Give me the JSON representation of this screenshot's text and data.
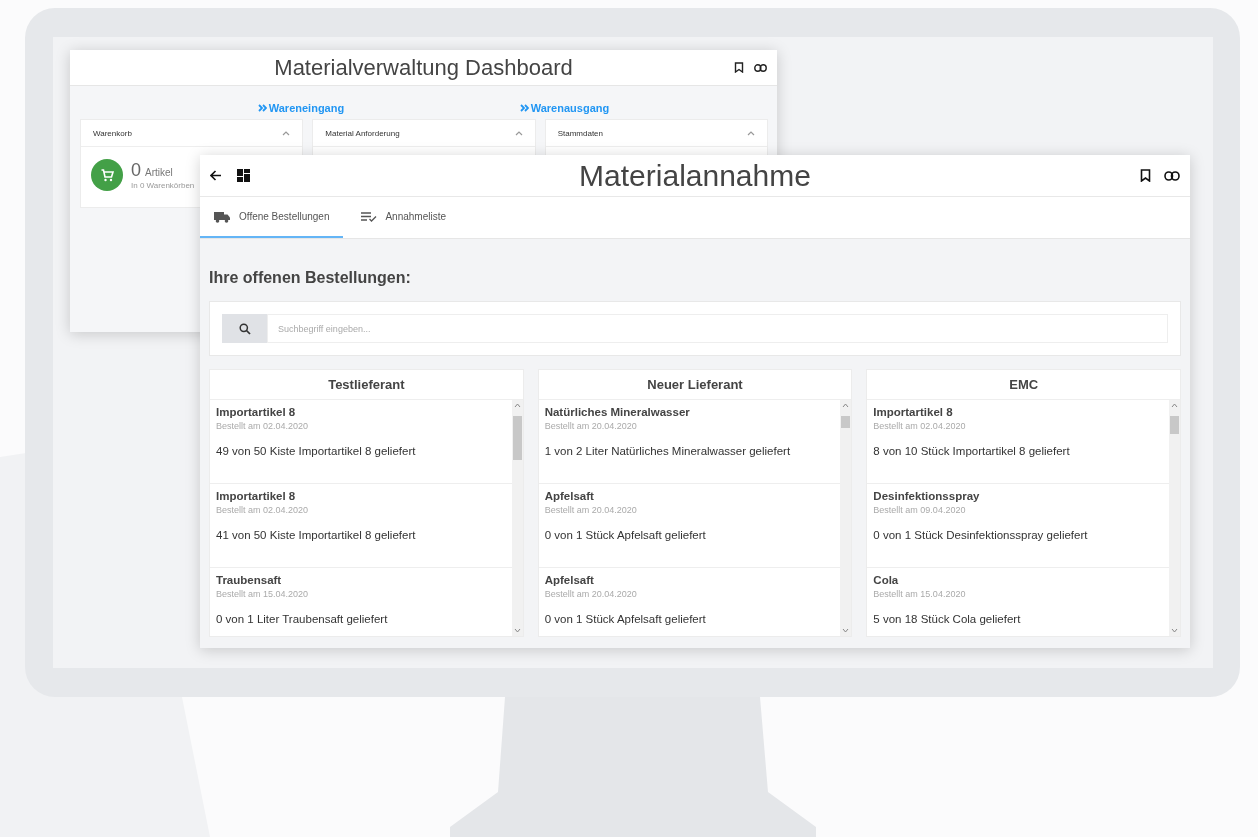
{
  "dashboard_window": {
    "title": "Materialverwaltung Dashboard",
    "links": [
      "Wareneingang",
      "Warenausgang"
    ],
    "cards": [
      {
        "title": "Warenkorb"
      },
      {
        "title": "Material Anforderung"
      },
      {
        "title": "Stammdaten"
      }
    ],
    "cart": {
      "count": "0",
      "unit": "Artikel",
      "subtitle": "In 0 Warenkörben"
    }
  },
  "main_window": {
    "title": "Materialannahme",
    "tabs": [
      {
        "label": "Offene Bestellungen",
        "kind": "truck",
        "selected": true
      },
      {
        "label": "Annahmeliste",
        "kind": "checklist",
        "selected": false
      }
    ],
    "heading": "Ihre offenen Bestellungen:",
    "search": {
      "placeholder": "Suchbegriff eingeben..."
    },
    "suppliers": [
      {
        "name": "Testlieferant",
        "orders": [
          {
            "item": "Importartikel 8",
            "date": "Bestellt am 02.04.2020",
            "status": "49 von 50 Kiste Importartikel 8 geliefert"
          },
          {
            "item": "Importartikel 8",
            "date": "Bestellt am 02.04.2020",
            "status": "41 von 50 Kiste Importartikel 8 geliefert"
          },
          {
            "item": "Traubensaft",
            "date": "Bestellt am 15.04.2020",
            "status": "0 von 1 Liter Traubensaft geliefert"
          }
        ]
      },
      {
        "name": "Neuer Lieferant",
        "orders": [
          {
            "item": "Natürliches Mineralwasser",
            "date": "Bestellt am 20.04.2020",
            "status": "1 von 2 Liter Natürliches Mineralwasser geliefert"
          },
          {
            "item": "Apfelsaft",
            "date": "Bestellt am 20.04.2020",
            "status": "0 von 1 Stück Apfelsaft geliefert"
          },
          {
            "item": "Apfelsaft",
            "date": "Bestellt am 20.04.2020",
            "status": "0 von 1 Stück Apfelsaft geliefert"
          }
        ]
      },
      {
        "name": "EMC",
        "orders": [
          {
            "item": "Importartikel 8",
            "date": "Bestellt am 02.04.2020",
            "status": "8 von 10 Stück Importartikel 8 geliefert"
          },
          {
            "item": "Desinfektionsspray",
            "date": "Bestellt am 09.04.2020",
            "status": "0 von 1 Stück Desinfektionsspray geliefert"
          },
          {
            "item": "Cola",
            "date": "Bestellt am 15.04.2020",
            "status": "5 von 18 Stück Cola geliefert"
          }
        ]
      }
    ]
  }
}
